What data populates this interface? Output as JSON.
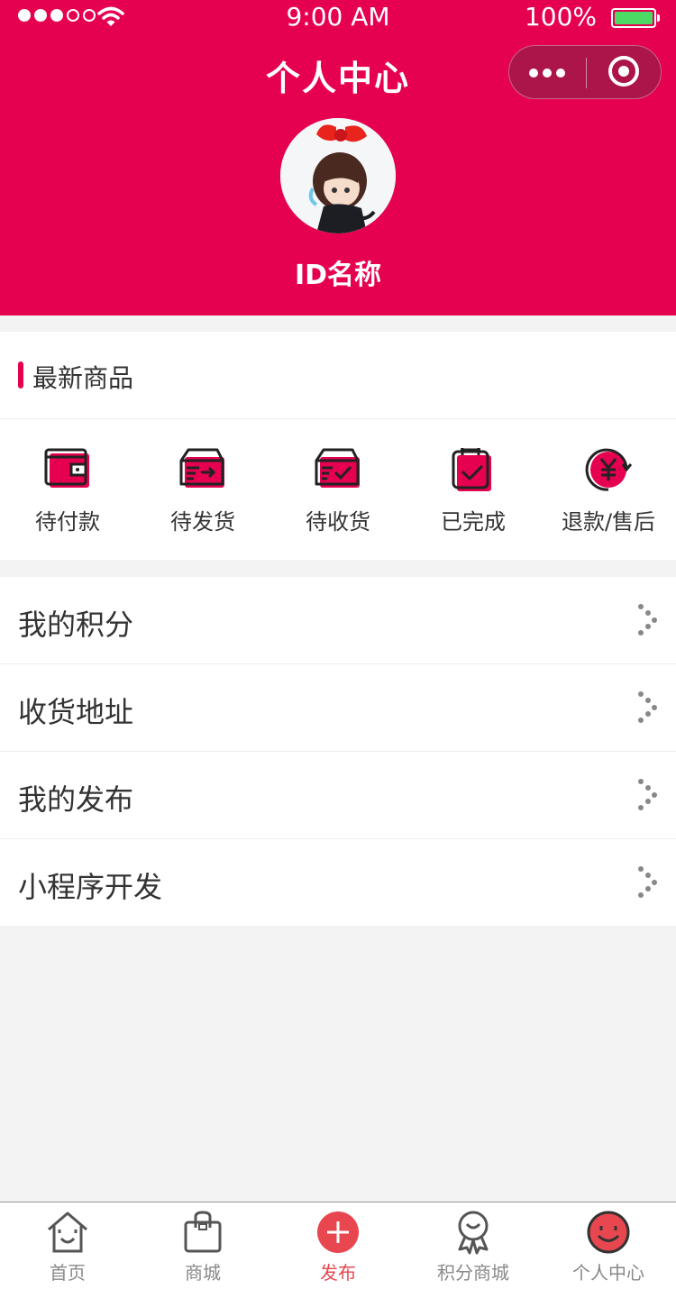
{
  "statusbar": {
    "time": "9:00 AM",
    "battery": "100%"
  },
  "header": {
    "title": "个人中心",
    "username": "ID名称"
  },
  "orders": {
    "section_label": "最新商品",
    "items": [
      {
        "label": "待付款",
        "icon": "wallet-icon"
      },
      {
        "label": "待发货",
        "icon": "box-ship-icon"
      },
      {
        "label": "待收货",
        "icon": "box-check-icon"
      },
      {
        "label": "已完成",
        "icon": "clipboard-check-icon"
      },
      {
        "label": "退款/售后",
        "icon": "yuan-refund-icon"
      }
    ]
  },
  "menu": [
    {
      "label": "我的积分"
    },
    {
      "label": "收货地址"
    },
    {
      "label": "我的发布"
    },
    {
      "label": "小程序开发"
    }
  ],
  "tabbar": [
    {
      "label": "首页",
      "icon": "home-icon"
    },
    {
      "label": "商城",
      "icon": "shopping-bag-icon"
    },
    {
      "label": "发布",
      "icon": "plus-circle-icon"
    },
    {
      "label": "积分商城",
      "icon": "award-icon"
    },
    {
      "label": "个人中心",
      "icon": "smile-face-icon"
    }
  ],
  "colors": {
    "brand": "#e60050",
    "active_tab": "#e8474f",
    "background": "#f3f3f3"
  }
}
